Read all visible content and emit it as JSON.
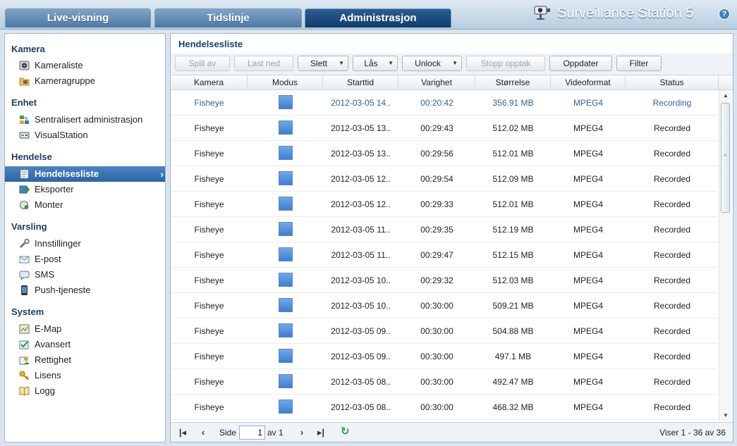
{
  "tabs": [
    {
      "label": "Live-visning",
      "active": false
    },
    {
      "label": "Tidslinje",
      "active": false
    },
    {
      "label": "Administrasjon",
      "active": true
    }
  ],
  "app": {
    "title": "Surveillance Station 5",
    "help": "?",
    "logo_icon": "camera-logo-icon"
  },
  "sidebar": {
    "sections": [
      {
        "title": "Kamera",
        "items": [
          {
            "label": "Kameraliste",
            "icon": "camera-icon"
          },
          {
            "label": "Kameragruppe",
            "icon": "camera-folder-icon"
          }
        ]
      },
      {
        "title": "Enhet",
        "items": [
          {
            "label": "Sentralisert administrasjon",
            "icon": "network-icon"
          },
          {
            "label": "VisualStation",
            "icon": "device-icon"
          }
        ]
      },
      {
        "title": "Hendelse",
        "items": [
          {
            "label": "Hendelsesliste",
            "icon": "event-list-icon",
            "selected": true
          },
          {
            "label": "Eksporter",
            "icon": "export-icon"
          },
          {
            "label": "Monter",
            "icon": "mount-icon"
          }
        ]
      },
      {
        "title": "Varsling",
        "items": [
          {
            "label": "Innstillinger",
            "icon": "wrench-icon"
          },
          {
            "label": "E-post",
            "icon": "mail-icon"
          },
          {
            "label": "SMS",
            "icon": "sms-icon"
          },
          {
            "label": "Push-tjeneste",
            "icon": "phone-icon"
          }
        ]
      },
      {
        "title": "System",
        "items": [
          {
            "label": "E-Map",
            "icon": "map-icon"
          },
          {
            "label": "Avansert",
            "icon": "advanced-icon"
          },
          {
            "label": "Rettighet",
            "icon": "privilege-icon"
          },
          {
            "label": "Lisens",
            "icon": "key-icon"
          },
          {
            "label": "Logg",
            "icon": "log-book-icon"
          }
        ]
      }
    ]
  },
  "panel": {
    "title": "Hendelsesliste"
  },
  "toolbar": {
    "buttons": [
      {
        "label": "Spill av",
        "disabled": true,
        "dropdown": false
      },
      {
        "label": "Last ned",
        "disabled": true,
        "dropdown": false
      },
      {
        "label": "Slett",
        "disabled": false,
        "dropdown": true
      },
      {
        "label": "Lås",
        "disabled": false,
        "dropdown": true
      },
      {
        "label": "Unlock",
        "disabled": false,
        "dropdown": true
      },
      {
        "label": "Stopp opptak",
        "disabled": true,
        "dropdown": false
      },
      {
        "label": "Oppdater",
        "disabled": false,
        "dropdown": false
      },
      {
        "label": "Filter",
        "disabled": false,
        "dropdown": false
      }
    ]
  },
  "table": {
    "columns": [
      "Kamera",
      "Modus",
      "Starttid",
      "Varighet",
      "Størrelse",
      "Videoformat",
      "Status"
    ],
    "rows": [
      {
        "camera": "Fisheye",
        "start": "2012-03-05 14..",
        "duration": "00:20:42",
        "size": "356.91 MB",
        "format": "MPEG4",
        "status": "Recording",
        "live": true
      },
      {
        "camera": "Fisheye",
        "start": "2012-03-05 13..",
        "duration": "00:29:43",
        "size": "512.02 MB",
        "format": "MPEG4",
        "status": "Recorded"
      },
      {
        "camera": "Fisheye",
        "start": "2012-03-05 13..",
        "duration": "00:29:56",
        "size": "512.01 MB",
        "format": "MPEG4",
        "status": "Recorded"
      },
      {
        "camera": "Fisheye",
        "start": "2012-03-05 12..",
        "duration": "00:29:54",
        "size": "512.09 MB",
        "format": "MPEG4",
        "status": "Recorded"
      },
      {
        "camera": "Fisheye",
        "start": "2012-03-05 12..",
        "duration": "00:29:33",
        "size": "512.01 MB",
        "format": "MPEG4",
        "status": "Recorded"
      },
      {
        "camera": "Fisheye",
        "start": "2012-03-05 11..",
        "duration": "00:29:35",
        "size": "512.19 MB",
        "format": "MPEG4",
        "status": "Recorded"
      },
      {
        "camera": "Fisheye",
        "start": "2012-03-05 11..",
        "duration": "00:29:47",
        "size": "512.15 MB",
        "format": "MPEG4",
        "status": "Recorded"
      },
      {
        "camera": "Fisheye",
        "start": "2012-03-05 10..",
        "duration": "00:29:32",
        "size": "512.03 MB",
        "format": "MPEG4",
        "status": "Recorded"
      },
      {
        "camera": "Fisheye",
        "start": "2012-03-05 10..",
        "duration": "00:30:00",
        "size": "509.21 MB",
        "format": "MPEG4",
        "status": "Recorded"
      },
      {
        "camera": "Fisheye",
        "start": "2012-03-05 09..",
        "duration": "00:30:00",
        "size": "504.88 MB",
        "format": "MPEG4",
        "status": "Recorded"
      },
      {
        "camera": "Fisheye",
        "start": "2012-03-05 09..",
        "duration": "00:30:00",
        "size": "497.1 MB",
        "format": "MPEG4",
        "status": "Recorded"
      },
      {
        "camera": "Fisheye",
        "start": "2012-03-05 08..",
        "duration": "00:30:00",
        "size": "492.47 MB",
        "format": "MPEG4",
        "status": "Recorded"
      },
      {
        "camera": "Fisheye",
        "start": "2012-03-05 08..",
        "duration": "00:30:00",
        "size": "468.32 MB",
        "format": "MPEG4",
        "status": "Recorded"
      }
    ]
  },
  "pager": {
    "page_label": "Side",
    "page_value": "1",
    "of_label": "av 1",
    "summary": "Viser 1 - 36 av 36"
  },
  "colors": {
    "accent": "#2d64a3",
    "live_row_text": "#2e62a3",
    "header_text": "#1b3e67",
    "mode_square": "#4a8ad8"
  }
}
